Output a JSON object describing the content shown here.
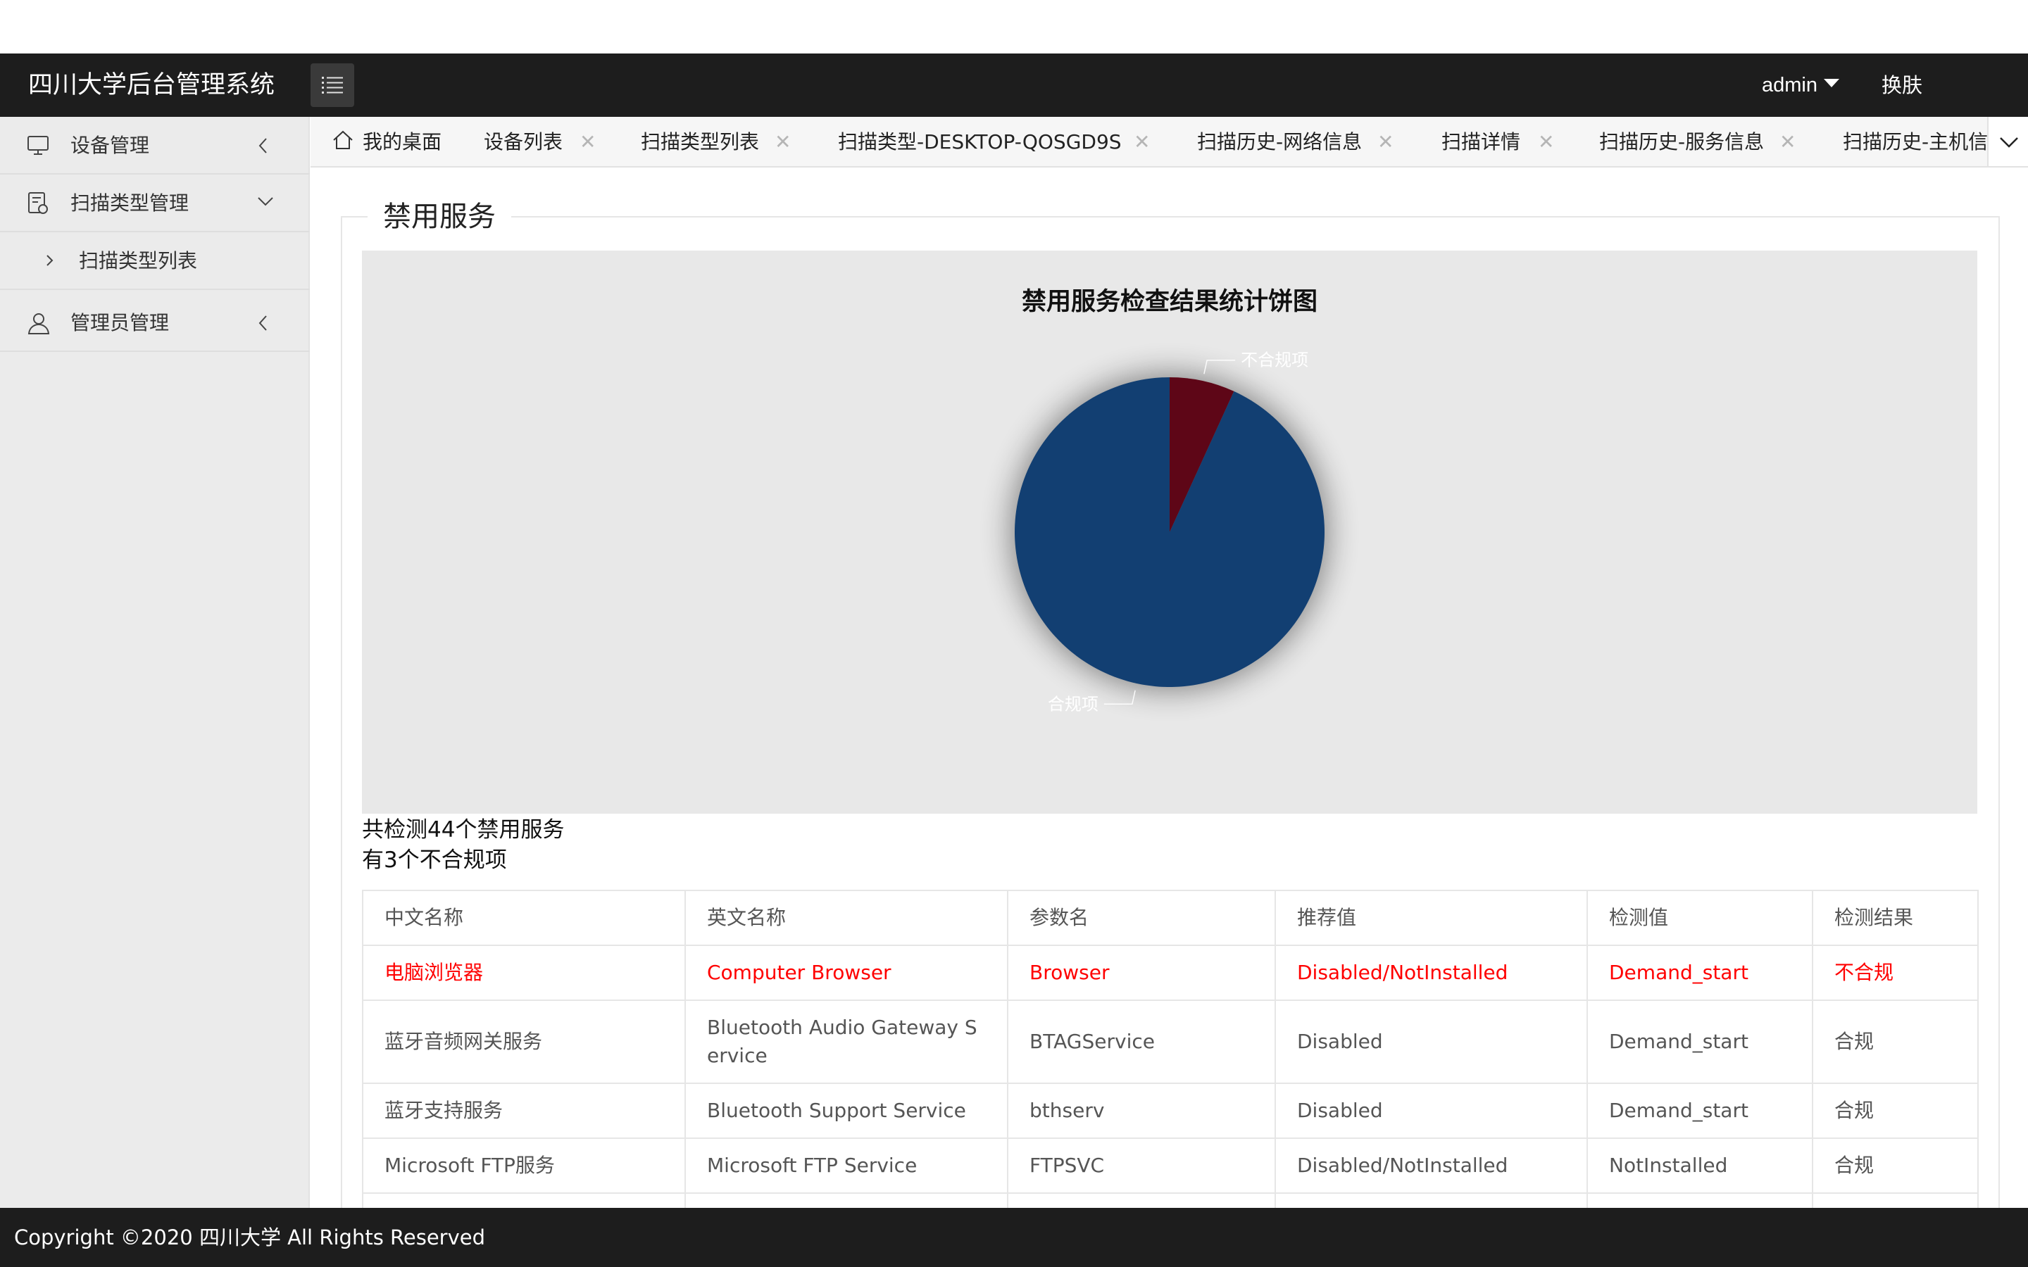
{
  "header": {
    "app_title": "四川大学后台管理系统",
    "user": "admin",
    "skin_label": "换肤"
  },
  "sidebar": {
    "items": [
      {
        "label": "设备管理",
        "icon": "monitor-icon"
      },
      {
        "label": "扫描类型管理",
        "icon": "document-icon"
      },
      {
        "label": "扫描类型列表",
        "icon": "chevron-right-icon"
      },
      {
        "label": "管理员管理",
        "icon": "user-icon"
      }
    ]
  },
  "tabs": [
    {
      "label": "我的桌面"
    },
    {
      "label": "设备列表"
    },
    {
      "label": "扫描类型列表"
    },
    {
      "label": "扫描类型-DESKTOP-QOSGD9S"
    },
    {
      "label": "扫描历史-网络信息"
    },
    {
      "label": "扫描详情"
    },
    {
      "label": "扫描历史-服务信息"
    },
    {
      "label": "扫描历史-主机信"
    }
  ],
  "tab_close_glyph": "✕",
  "section": {
    "legend": "禁用服务",
    "summary_total": "共检测44个禁用服务",
    "summary_noncompliant": "有3个不合规项"
  },
  "chart_data": {
    "type": "pie",
    "title": "禁用服务检查结果统计饼图",
    "slices": [
      {
        "label": "不合规项",
        "value": 3,
        "color": "#5e0617"
      },
      {
        "label": "合规项",
        "value": 41,
        "color": "#123f72"
      }
    ]
  },
  "table": {
    "headers": [
      "中文名称",
      "英文名称",
      "参数名",
      "推荐值",
      "检测值",
      "检测结果"
    ],
    "rows": [
      {
        "cells": [
          "电脑浏览器",
          "Computer Browser",
          "Browser",
          "Disabled/NotInstalled",
          "Demand_start",
          "不合规"
        ],
        "status": "bad"
      },
      {
        "cells": [
          "蓝牙音频网关服务",
          "Bluetooth Audio Gateway Service",
          "BTAGService",
          "Disabled",
          "Demand_start",
          "合规"
        ],
        "status": "ok"
      },
      {
        "cells": [
          "蓝牙支持服务",
          "Bluetooth Support Service",
          "bthserv",
          "Disabled",
          "Demand_start",
          "合规"
        ],
        "status": "ok"
      },
      {
        "cells": [
          "Microsoft FTP服务",
          "Microsoft FTP Service",
          "FTPSVC",
          "Disabled/NotInstalled",
          "NotInstalled",
          "合规"
        ],
        "status": "ok"
      }
    ]
  },
  "footer": {
    "copyright": "Copyright ©2020 四川大学 All Rights Reserved"
  }
}
